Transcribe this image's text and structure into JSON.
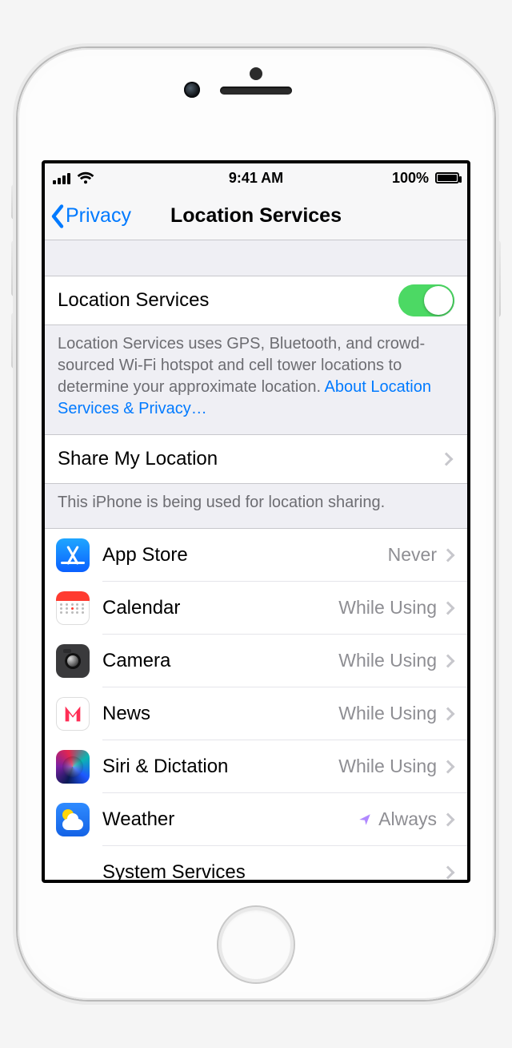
{
  "statusbar": {
    "time": "9:41 AM",
    "battery_pct": "100%"
  },
  "nav": {
    "back_label": "Privacy",
    "title": "Location Services"
  },
  "master": {
    "label": "Location Services",
    "on": true
  },
  "master_footer": {
    "text": "Location Services uses GPS, Bluetooth, and crowd-sourced Wi-Fi hotspot and cell tower locations to determine your approximate location. ",
    "link": "About Location Services & Privacy…"
  },
  "share": {
    "label": "Share My Location",
    "footer": "This iPhone is being used for location sharing."
  },
  "apps": [
    {
      "icon": "appstore",
      "name": "App Store",
      "value": "Never",
      "indicator": false
    },
    {
      "icon": "calendar",
      "name": "Calendar",
      "value": "While Using",
      "indicator": false
    },
    {
      "icon": "camera",
      "name": "Camera",
      "value": "While Using",
      "indicator": false
    },
    {
      "icon": "news",
      "name": "News",
      "value": "While Using",
      "indicator": false
    },
    {
      "icon": "siri",
      "name": "Siri & Dictation",
      "value": "While Using",
      "indicator": false
    },
    {
      "icon": "weather",
      "name": "Weather",
      "value": "Always",
      "indicator": true
    }
  ],
  "system_services": {
    "label": "System Services"
  }
}
